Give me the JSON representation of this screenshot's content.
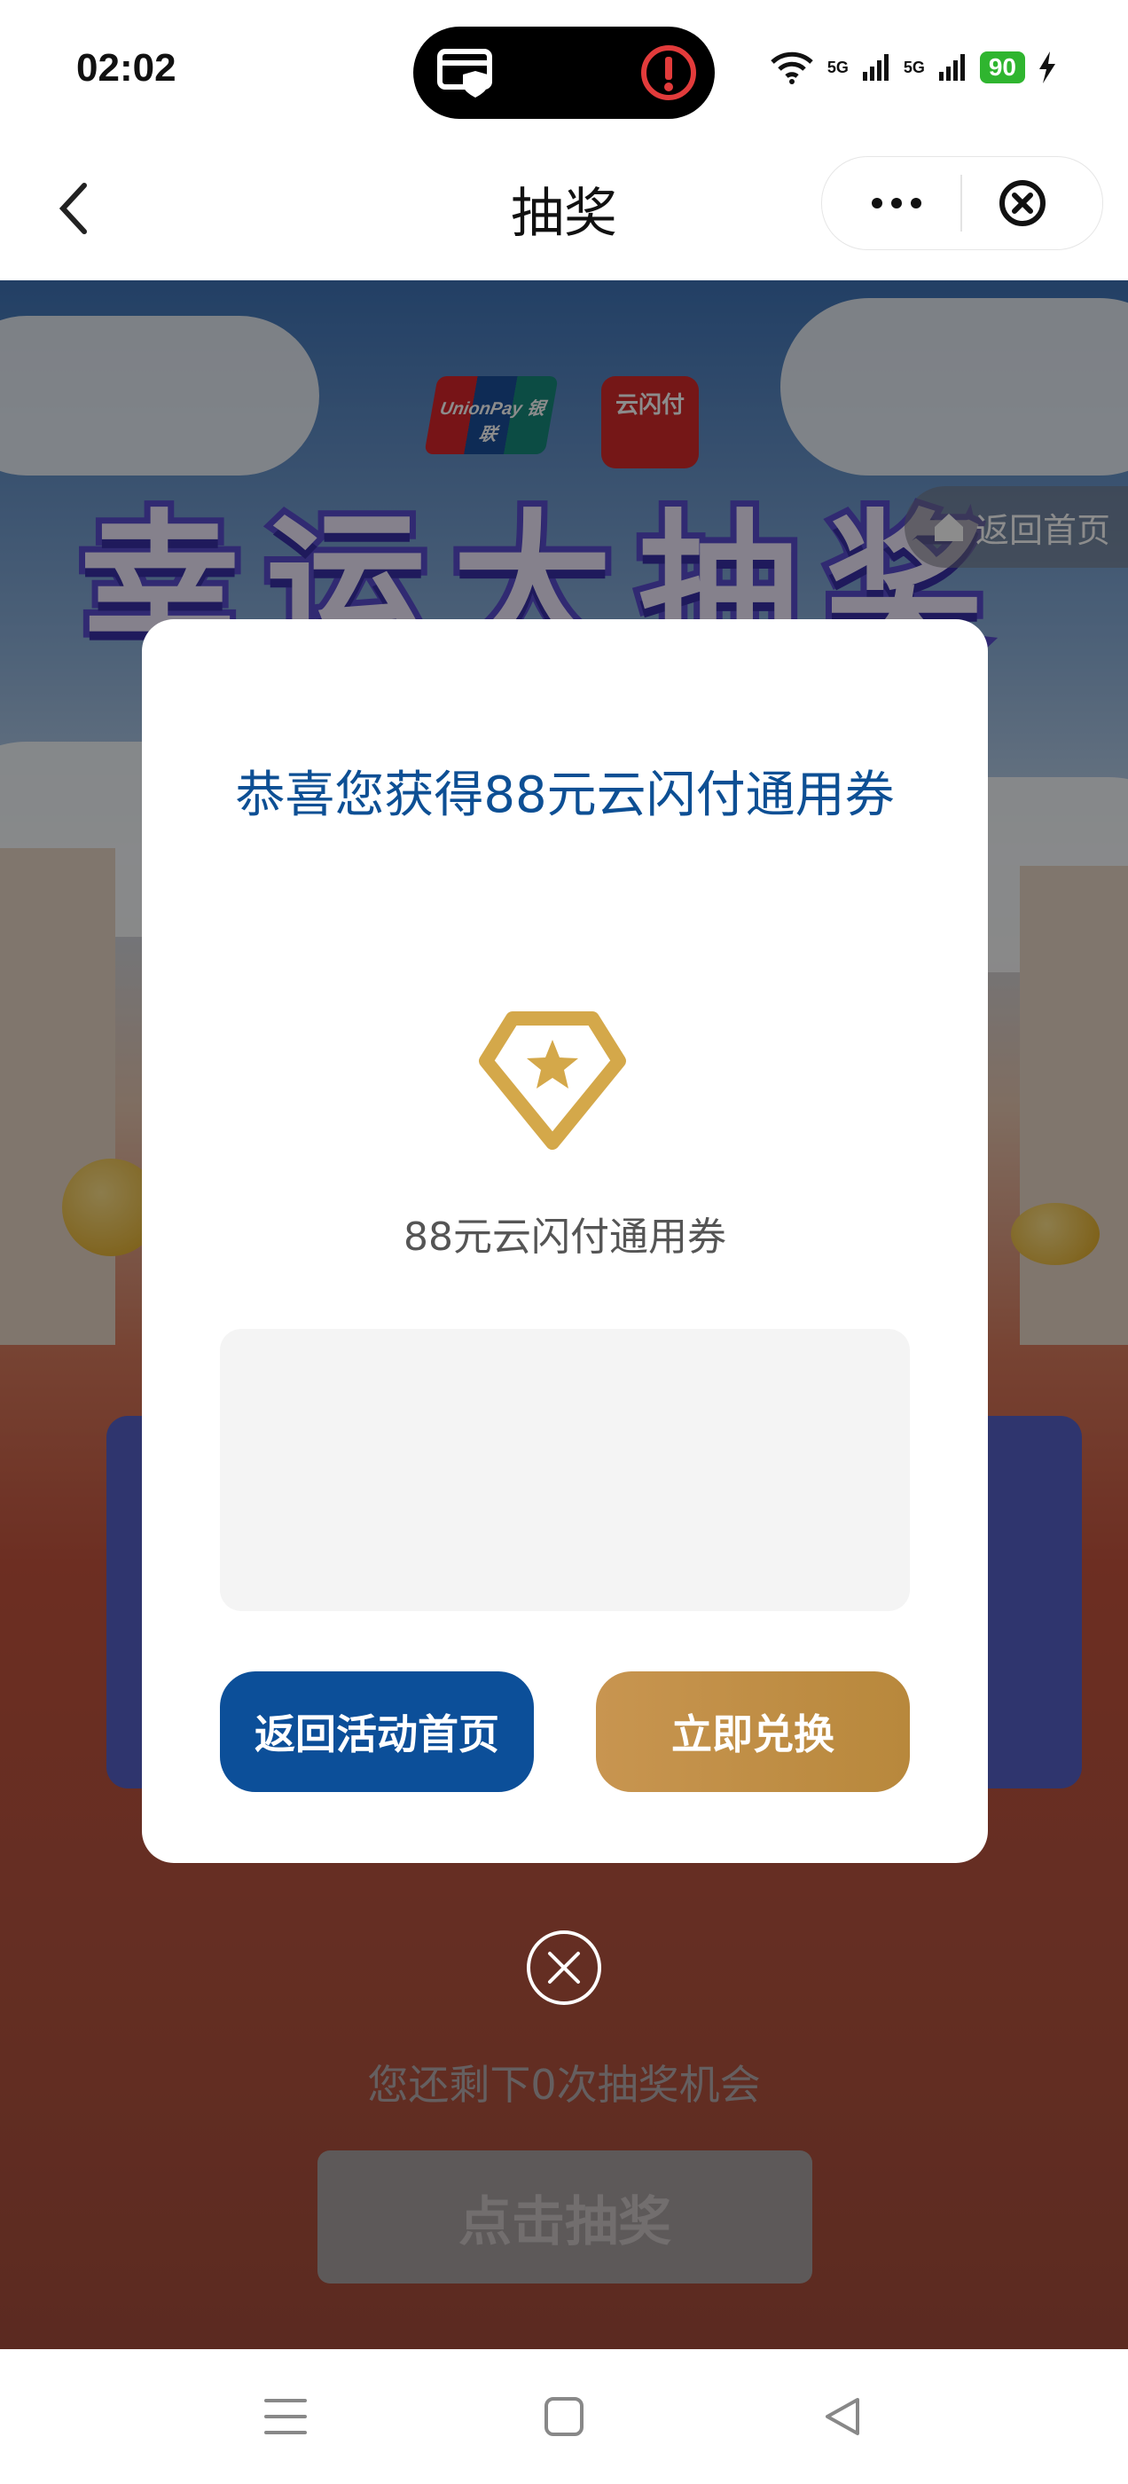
{
  "status_bar": {
    "time": "02:02",
    "network_left": "5G",
    "network_right": "5G",
    "battery": "90"
  },
  "nav": {
    "title": "抽奖"
  },
  "activity": {
    "brand_unionpay": "UnionPay 银联",
    "brand_yunshanfu": "云闪付",
    "headline": "幸运大抽奖",
    "home_link": "返回首页",
    "remaining_text": "您还剩下0次抽奖机会",
    "draw_button": "点击抽奖"
  },
  "modal": {
    "title": "恭喜您获得88元云闪付通用券",
    "prize_name": "88元云闪付通用券",
    "back_button": "返回活动首页",
    "redeem_button": "立即兑换"
  },
  "colors": {
    "primary_blue": "#0c4f99",
    "gold": "#c89550",
    "battery_green": "#2fb52f"
  }
}
